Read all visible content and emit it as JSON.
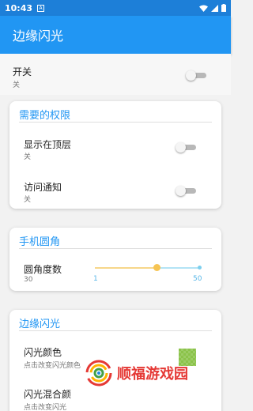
{
  "status_bar": {
    "time": "10:43",
    "notification_glyph": "A",
    "icons": [
      "wifi-icon",
      "signal-icon",
      "battery-icon"
    ]
  },
  "app_bar": {
    "title": "边缘闪光",
    "color": "#2196f3"
  },
  "master_switch": {
    "title": "开关",
    "state_label": "关",
    "on": false
  },
  "permissions": {
    "header": "需要的权限",
    "items": [
      {
        "title": "显示在顶层",
        "state_label": "关",
        "on": false
      },
      {
        "title": "访问通知",
        "state_label": "关",
        "on": false
      }
    ]
  },
  "corner": {
    "header": "手机圆角",
    "slider": {
      "label": "圆角度数",
      "value": 30,
      "min": 1,
      "max": 50,
      "min_label": "1",
      "max_label": "50"
    }
  },
  "edge_flash": {
    "header": "边缘闪光",
    "items": [
      {
        "title": "闪光颜色",
        "subtitle": "点击改变闪光颜色",
        "color": "#8bc34a"
      },
      {
        "title": "闪光混合颜",
        "subtitle": "点击改变闪光"
      }
    ]
  },
  "watermark": {
    "text": "顺福游戏园"
  }
}
